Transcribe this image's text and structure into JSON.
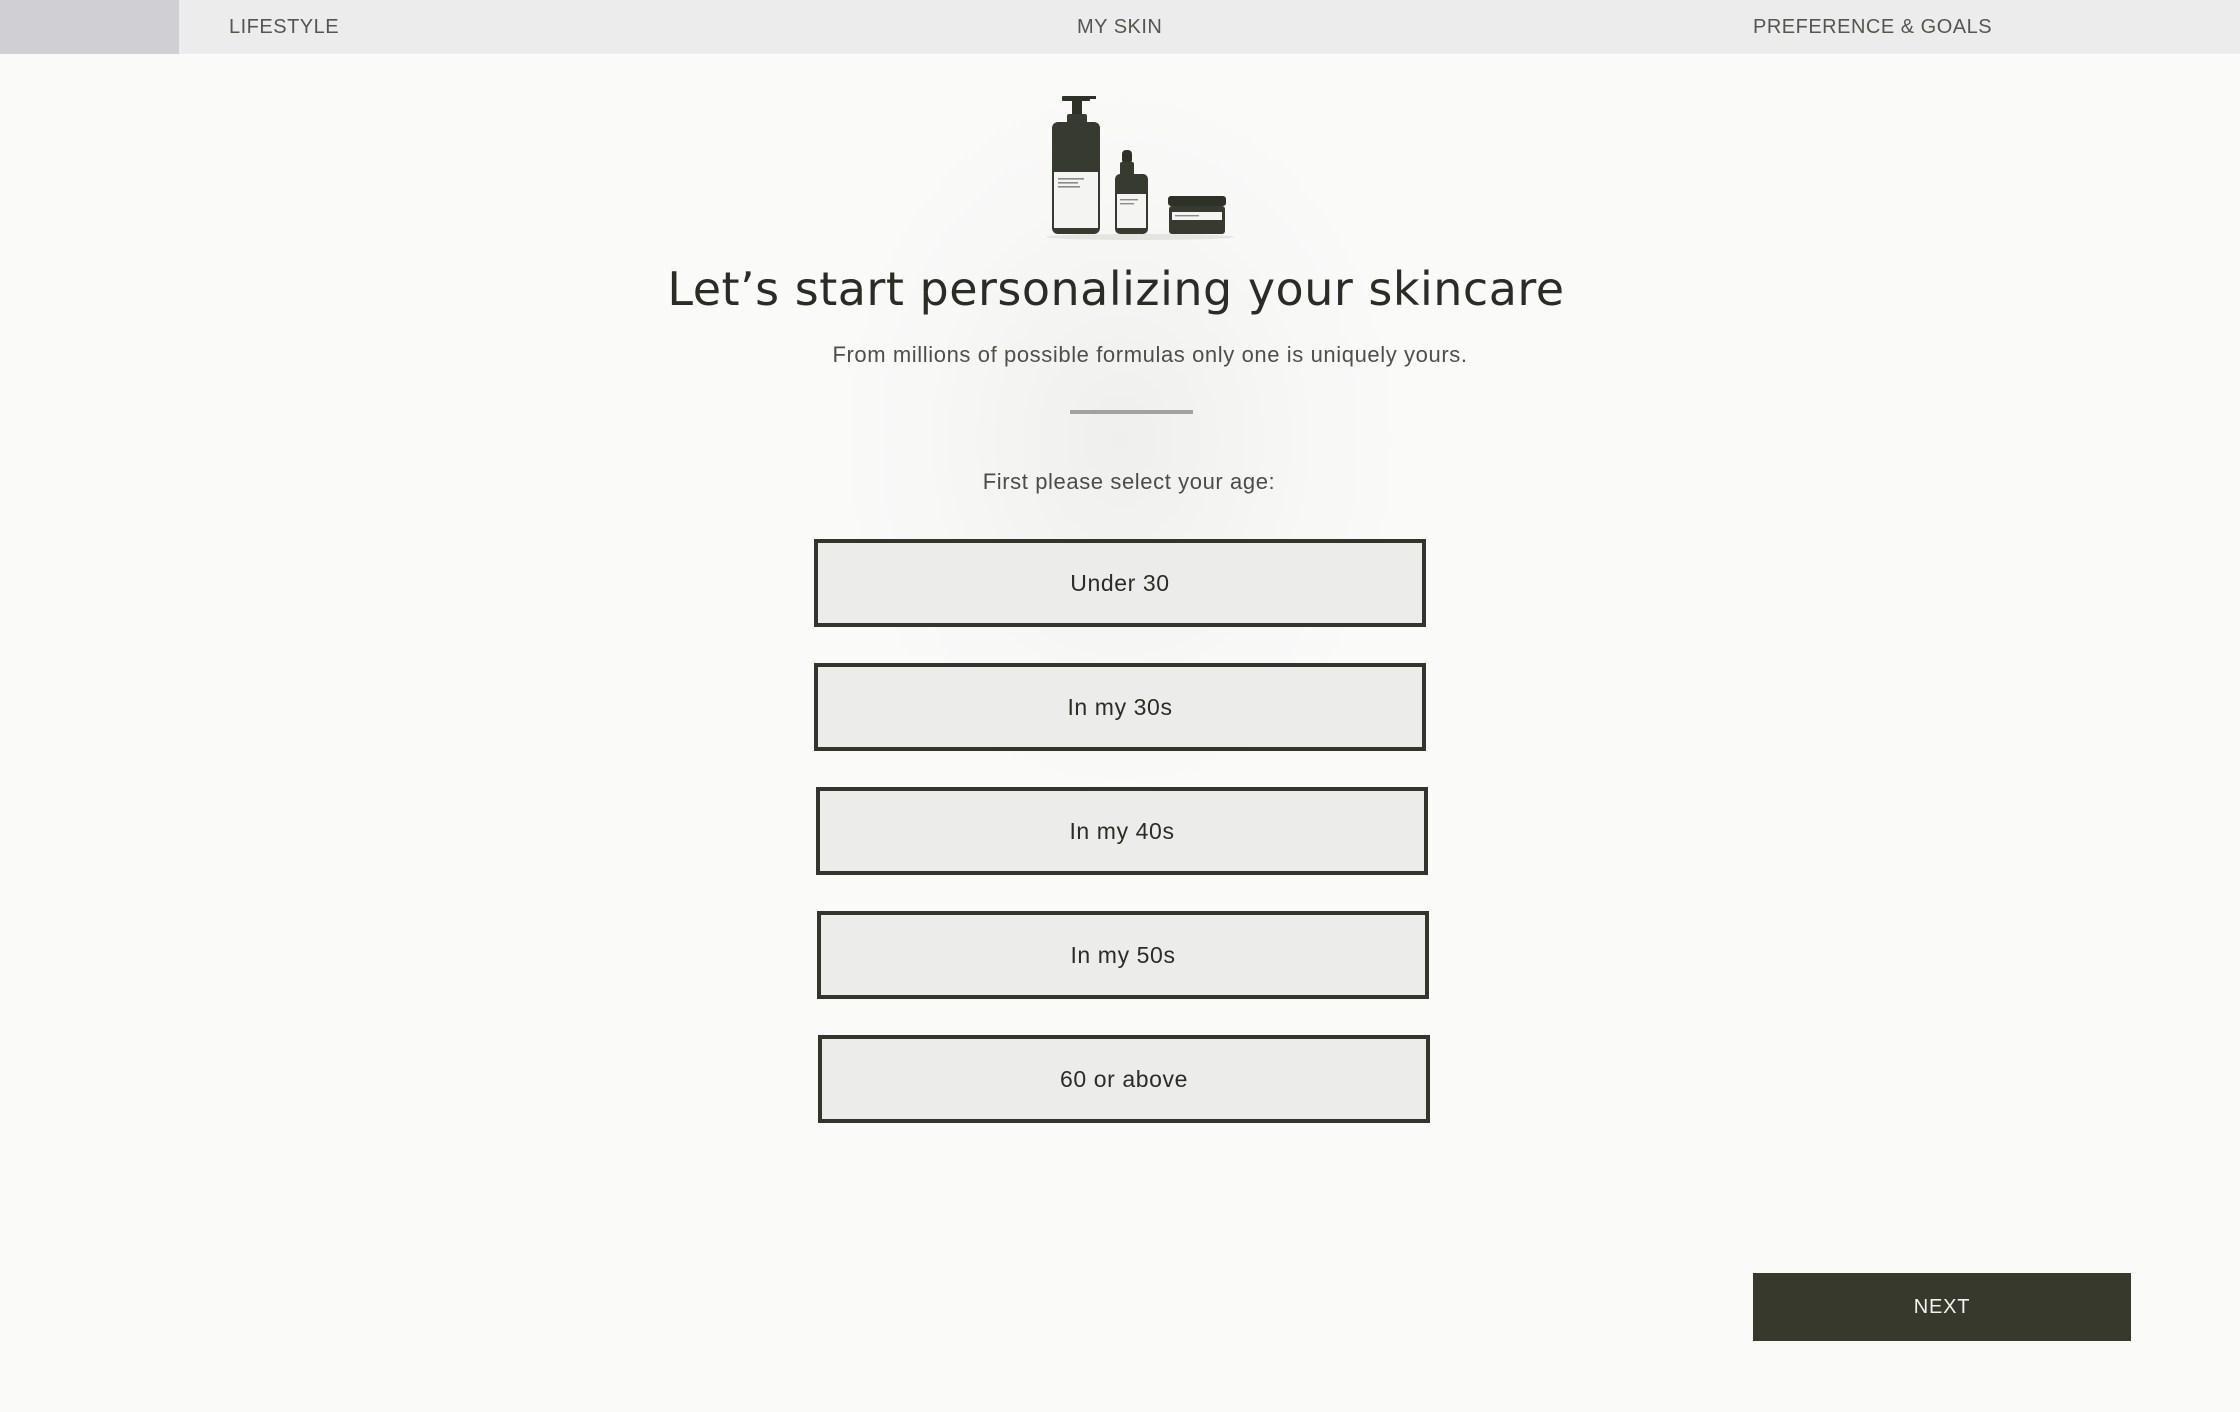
{
  "nav": {
    "progress_fraction": 0.08,
    "steps": [
      {
        "label": "LIFESTYLE"
      },
      {
        "label": "MY SKIN"
      },
      {
        "label": "PREFERENCE & GOALS"
      }
    ]
  },
  "hero": {
    "title": "Let’s start personalizing your skincare",
    "subtitle": "From millions of possible formulas only one is uniquely yours."
  },
  "question": {
    "prompt": "First please select your age:",
    "options": [
      {
        "label": "Under 30"
      },
      {
        "label": "In my 30s"
      },
      {
        "label": "In my 40s"
      },
      {
        "label": "In my 50s"
      },
      {
        "label": "60 or above"
      }
    ]
  },
  "actions": {
    "next_label": "NEXT"
  },
  "colors": {
    "accent_dark": "#37392d",
    "nav_background": "#ececec",
    "progress_fill": "#cfcfd4",
    "page_background": "#fafaf9"
  },
  "icons": {
    "hero_illustration": "skincare-products-illustration"
  }
}
